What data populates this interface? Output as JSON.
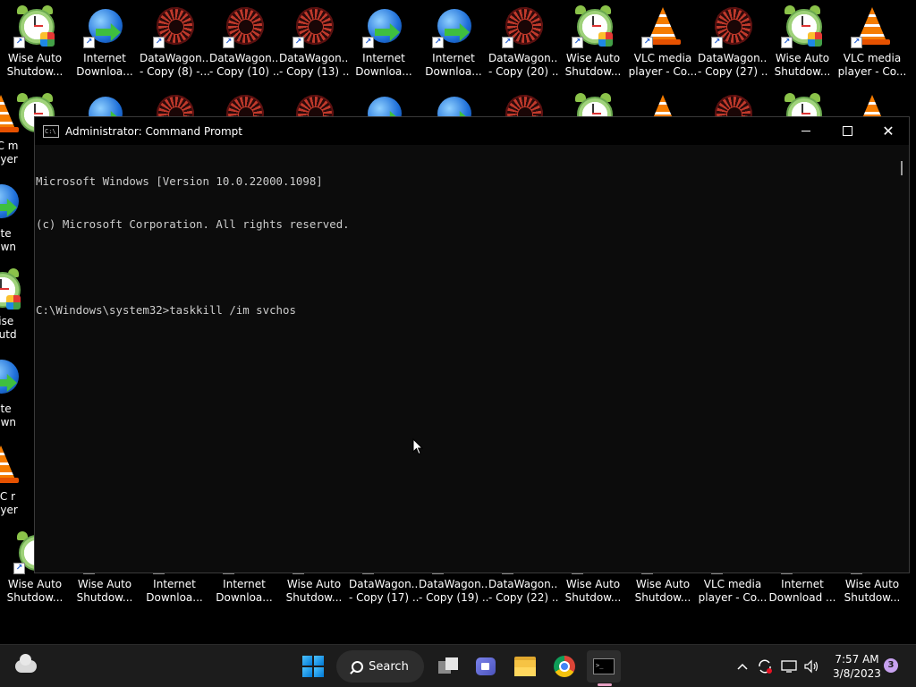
{
  "desktop": {
    "top_row": [
      {
        "label1": "Wise Auto",
        "label2": "Shutdow...",
        "icon": "wise-auto-shutdown-icon",
        "type": "wise"
      },
      {
        "label1": "Internet",
        "label2": "Downloa...",
        "icon": "internet-download-manager-icon",
        "type": "idm"
      },
      {
        "label1": "DataWagon....",
        "label2": "- Copy (8) -...",
        "icon": "datawagon-icon",
        "type": "dw"
      },
      {
        "label1": "DataWagon...",
        "label2": "- Copy (10) ...",
        "icon": "datawagon-icon",
        "type": "dw"
      },
      {
        "label1": "DataWagon...",
        "label2": "- Copy (13) ...",
        "icon": "datawagon-icon",
        "type": "dw"
      },
      {
        "label1": "Internet",
        "label2": "Downloa...",
        "icon": "internet-download-manager-icon",
        "type": "idm"
      },
      {
        "label1": "Internet",
        "label2": "Downloa...",
        "icon": "internet-download-manager-icon",
        "type": "idm"
      },
      {
        "label1": "DataWagon...",
        "label2": "- Copy (20) ...",
        "icon": "datawagon-icon",
        "type": "dw"
      },
      {
        "label1": "Wise Auto",
        "label2": "Shutdow...",
        "icon": "wise-auto-shutdown-icon",
        "type": "wise"
      },
      {
        "label1": "VLC media",
        "label2": "player - Co...",
        "icon": "vlc-icon",
        "type": "vlc"
      },
      {
        "label1": "DataWagon...",
        "label2": "- Copy (27) ...",
        "icon": "datawagon-icon",
        "type": "dw"
      },
      {
        "label1": "Wise Auto",
        "label2": "Shutdow...",
        "icon": "wise-auto-shutdown-icon",
        "type": "wise"
      },
      {
        "label1": "VLC media",
        "label2": "player - Co...",
        "icon": "vlc-icon",
        "type": "vlc"
      }
    ],
    "left_column": [
      {
        "label1": "VLC m",
        "label2": "player",
        "icon": "vlc-icon",
        "type": "vlc"
      },
      {
        "label1": "Inte",
        "label2": "Down",
        "icon": "internet-download-manager-icon",
        "type": "idm"
      },
      {
        "label1": "Wise",
        "label2": "Shutd",
        "icon": "wise-auto-shutdown-icon",
        "type": "wise"
      },
      {
        "label1": "Inte",
        "label2": "Down",
        "icon": "internet-download-manager-icon",
        "type": "idm"
      },
      {
        "label1": "VLC r",
        "label2": "player",
        "icon": "vlc-icon",
        "type": "vlc"
      }
    ],
    "bottom_row": [
      {
        "label1": "Wise Auto",
        "label2": "Shutdow...",
        "icon": "wise-auto-shutdown-icon",
        "type": "wise"
      },
      {
        "label1": "Wise Auto",
        "label2": "Shutdow...",
        "icon": "wise-auto-shutdown-icon",
        "type": "wise"
      },
      {
        "label1": "Internet",
        "label2": "Downloa...",
        "icon": "internet-download-manager-icon",
        "type": "idm"
      },
      {
        "label1": "Internet",
        "label2": "Downloa...",
        "icon": "internet-download-manager-icon",
        "type": "idm"
      },
      {
        "label1": "Wise Auto",
        "label2": "Shutdow...",
        "icon": "wise-auto-shutdown-icon",
        "type": "wise"
      },
      {
        "label1": "DataWagon...",
        "label2": "- Copy (17) ...",
        "icon": "datawagon-icon",
        "type": "dw"
      },
      {
        "label1": "DataWagon...",
        "label2": "- Copy (19) ...",
        "icon": "datawagon-icon",
        "type": "dw"
      },
      {
        "label1": "DataWagon...",
        "label2": "- Copy (22) ...",
        "icon": "datawagon-icon",
        "type": "dw"
      },
      {
        "label1": "Wise Auto",
        "label2": "Shutdow...",
        "icon": "wise-auto-shutdown-icon",
        "type": "wise"
      },
      {
        "label1": "Wise Auto",
        "label2": "Shutdow...",
        "icon": "wise-auto-shutdown-icon",
        "type": "wise"
      },
      {
        "label1": "VLC media",
        "label2": "player - Co...",
        "icon": "vlc-icon",
        "type": "vlc"
      },
      {
        "label1": "Internet",
        "label2": "Download ...",
        "icon": "internet-download-manager-icon",
        "type": "idm"
      },
      {
        "label1": "Wise Auto",
        "label2": "Shutdow...",
        "icon": "wise-auto-shutdown-icon",
        "type": "wise"
      }
    ]
  },
  "window": {
    "title": "Administrator: Command Prompt",
    "app_icon_text": "C:\\",
    "console_lines": [
      "Microsoft Windows [Version 10.0.22000.1098]",
      "(c) Microsoft Corporation. All rights reserved.",
      "",
      "C:\\Windows\\system32>taskkill /im svchos"
    ]
  },
  "taskbar": {
    "search_label": "Search",
    "terminal_icon_text": ">_",
    "clock_time": "7:57 AM",
    "clock_date": "3/8/2023",
    "notification_count": "3",
    "chevron": "^"
  }
}
